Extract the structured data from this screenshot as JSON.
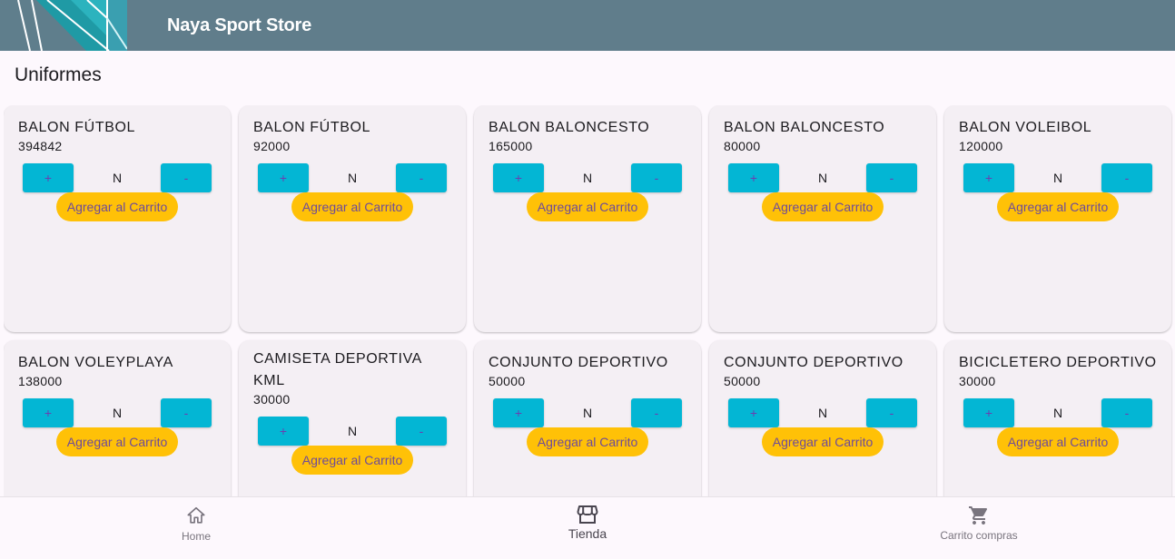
{
  "app": {
    "title": "Naya Sport Store"
  },
  "section_title": "Uniformes",
  "product_labels": {
    "plus": "+",
    "minus": "-",
    "quantity": "N",
    "add_to_cart": "Agregar al Carrito"
  },
  "products": [
    {
      "name": "BALON FÚTBOL",
      "price": "394842"
    },
    {
      "name": "BALON FÚTBOL",
      "price": "92000"
    },
    {
      "name": "BALON BALONCESTO",
      "price": "165000"
    },
    {
      "name": "BALON BALONCESTO",
      "price": "80000"
    },
    {
      "name": "BALON VOLEIBOL",
      "price": "120000"
    },
    {
      "name": "BALON VOLEYPLAYA",
      "price": "138000"
    },
    {
      "name": "CAMISETA DEPORTIVA KML",
      "price": "30000"
    },
    {
      "name": "CONJUNTO DEPORTIVO",
      "price": "50000"
    },
    {
      "name": "CONJUNTO DEPORTIVO",
      "price": "50000"
    },
    {
      "name": "BICICLETERO DEPORTIVO",
      "price": "30000"
    }
  ],
  "bottom_nav": {
    "items": [
      {
        "label": "Home",
        "icon": "home-icon"
      },
      {
        "label": "Tienda",
        "icon": "store-icon"
      },
      {
        "label": "Carrito compras",
        "icon": "cart-icon"
      }
    ],
    "active": "Tienda"
  },
  "colors": {
    "appbar": "#607d8b",
    "qty_button": "#03b6d4",
    "add_button": "#ffc107",
    "card": "#f4eff4"
  }
}
